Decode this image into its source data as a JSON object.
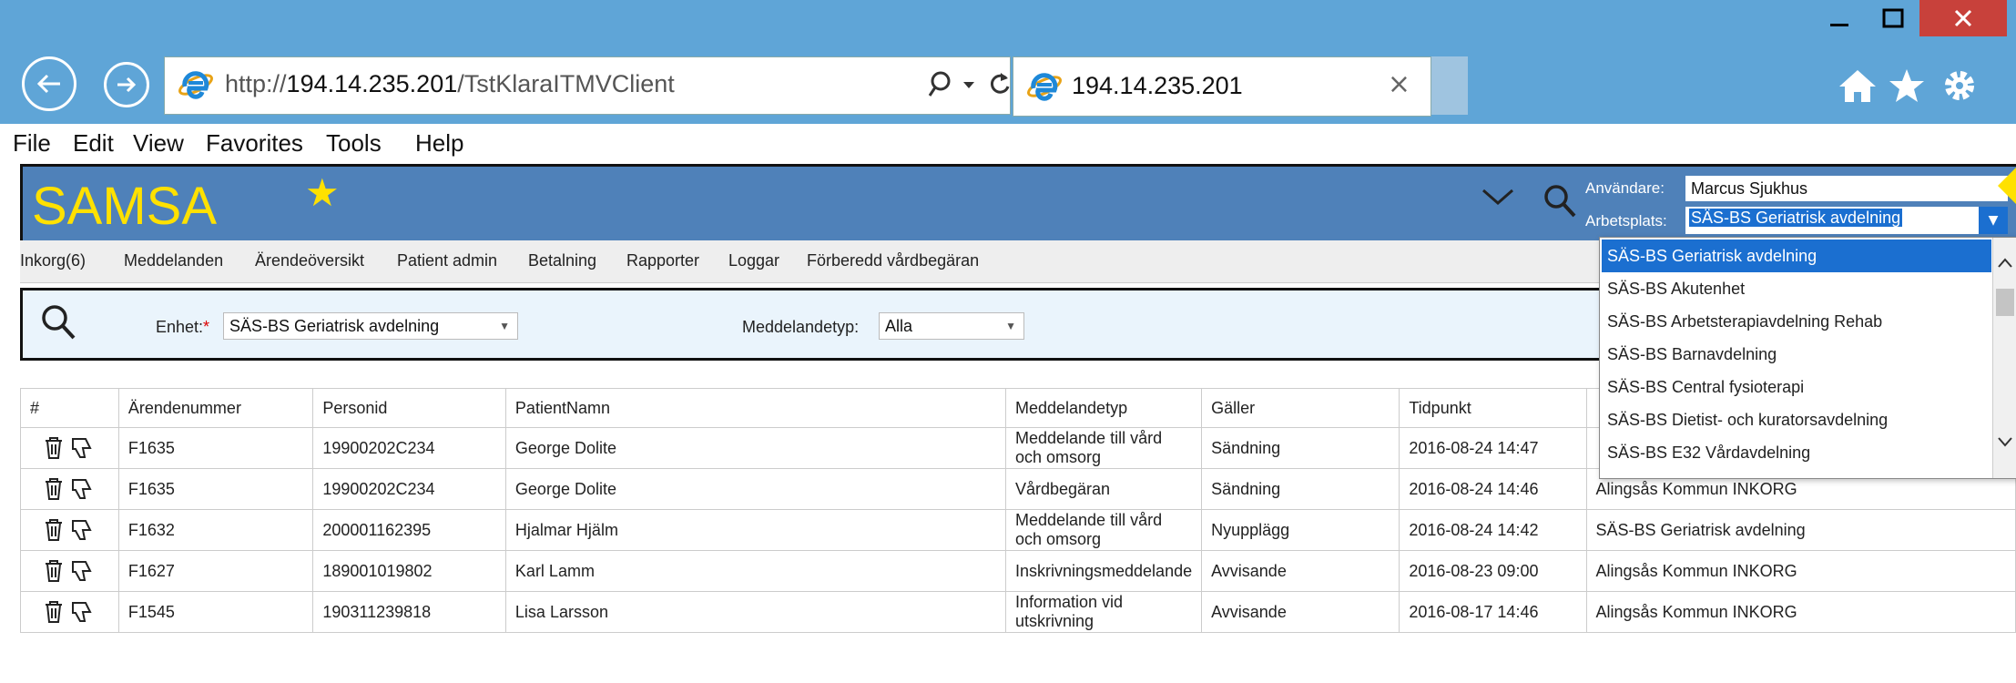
{
  "browser": {
    "url_prefix": "http://",
    "url_host": "194.14.235.201",
    "url_path": "/TstKlaraITMVClient",
    "tab_title": "194.14.235.201",
    "menu": [
      "File",
      "Edit",
      "View",
      "Favorites",
      "Tools",
      "Help"
    ]
  },
  "app": {
    "title": "SAMSA",
    "user_label": "Användare:",
    "user_value": "Marcus Sjukhus",
    "workplace_label": "Arbetsplats:",
    "workplace_value": "SÄS-BS Geriatrisk avdelning"
  },
  "nav": [
    "Inkorg(6)",
    "Meddelanden",
    "Ärendeöversikt",
    "Patient admin",
    "Betalning",
    "Rapporter",
    "Loggar",
    "Förberedd vårdbegäran"
  ],
  "filter": {
    "unit_label": "Enhet:",
    "unit_required": "*",
    "unit_value": "SÄS-BS Geriatrisk avdelning",
    "type_label": "Meddelandetyp:",
    "type_value": "Alla"
  },
  "table": {
    "columns": [
      "#",
      "Ärendenummer",
      "Personid",
      "PatientNamn",
      "Meddelandetyp",
      "Gäller",
      "Tidpunkt",
      ""
    ],
    "rows": [
      {
        "case": "F1635",
        "pid": "19900202C234",
        "name": "George Dolite",
        "type": "Meddelande till vård och omsorg",
        "applies": "Sändning",
        "time": "2016-08-24 14:47",
        "recipient": ""
      },
      {
        "case": "F1635",
        "pid": "19900202C234",
        "name": "George Dolite",
        "type": "Vårdbegäran",
        "applies": "Sändning",
        "time": "2016-08-24 14:46",
        "recipient": "Alingsås Kommun INKORG"
      },
      {
        "case": "F1632",
        "pid": "200001162395",
        "name": "Hjalmar Hjälm",
        "type": "Meddelande till vård och omsorg",
        "applies": "Nyupplägg",
        "time": "2016-08-24 14:42",
        "recipient": "SÄS-BS Geriatrisk avdelning"
      },
      {
        "case": "F1627",
        "pid": "189001019802",
        "name": "Karl Lamm",
        "type": "Inskrivningsmeddelande",
        "applies": "Avvisande",
        "time": "2016-08-23 09:00",
        "recipient": "Alingsås Kommun INKORG"
      },
      {
        "case": "F1545",
        "pid": "190311239818",
        "name": "Lisa Larsson",
        "type": "Information vid utskrivning",
        "applies": "Avvisande",
        "time": "2016-08-17 14:46",
        "recipient": "Alingsås Kommun INKORG"
      }
    ]
  },
  "dropdown": {
    "items": [
      "SÄS-BS Geriatrisk avdelning",
      "SÄS-BS Akutenhet",
      "SÄS-BS Arbetsterapiavdelning Rehab",
      "SÄS-BS Barnavdelning",
      "SÄS-BS Central fysioterapi",
      "SÄS-BS Dietist- och kuratorsavdelning",
      "SÄS-BS E32 Vårdavdelning"
    ]
  },
  "colors": {
    "chrome": "#5fa5d7",
    "header": "#4f81b9",
    "accent": "#ffe100",
    "selection": "#1b6fd0"
  }
}
